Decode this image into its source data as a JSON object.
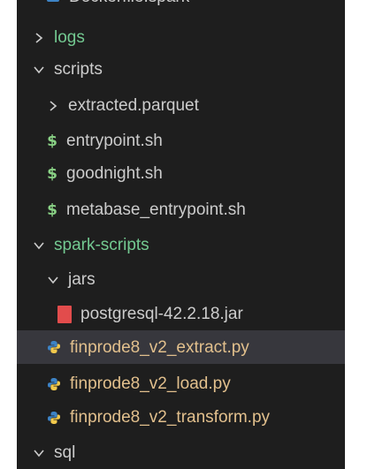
{
  "explorer": {
    "colors": {
      "background": "#1e1e1e",
      "selected_row": "#37373d",
      "text": "#cccccc",
      "git_untracked_folder": "#73c991",
      "git_modified_file": "#e2c08d",
      "shell_icon": "#89d185",
      "jar_icon": "#e24c4c",
      "python_icon_blue": "#3d83c5",
      "python_icon_yellow": "#f2c94c"
    },
    "items": [
      {
        "label": "Dockerfile.spark",
        "kind": "file",
        "icon": "docker-icon"
      },
      {
        "label": "logs",
        "kind": "folder",
        "state": "collapsed",
        "icon": "chevron-right-icon"
      },
      {
        "label": "scripts",
        "kind": "folder",
        "state": "expanded",
        "icon": "chevron-down-icon"
      },
      {
        "label": "extracted.parquet",
        "kind": "folder",
        "state": "collapsed",
        "icon": "chevron-right-icon"
      },
      {
        "label": "entrypoint.sh",
        "kind": "file",
        "icon": "shell-dollar-icon",
        "glyph": "$"
      },
      {
        "label": "goodnight.sh",
        "kind": "file",
        "icon": "shell-dollar-icon",
        "glyph": "$"
      },
      {
        "label": "metabase_entrypoint.sh",
        "kind": "file",
        "icon": "shell-dollar-icon",
        "glyph": "$"
      },
      {
        "label": "spark-scripts",
        "kind": "folder",
        "state": "expanded",
        "icon": "chevron-down-icon"
      },
      {
        "label": "jars",
        "kind": "folder",
        "state": "expanded",
        "icon": "chevron-down-icon"
      },
      {
        "label": "postgresql-42.2.18.jar",
        "kind": "file",
        "icon": "jar-icon"
      },
      {
        "label": "finprode8_v2_extract.py",
        "kind": "file",
        "icon": "python-icon",
        "selected": true
      },
      {
        "label": "finprode8_v2_load.py",
        "kind": "file",
        "icon": "python-icon"
      },
      {
        "label": "finprode8_v2_transform.py",
        "kind": "file",
        "icon": "python-icon"
      },
      {
        "label": "sql",
        "kind": "folder",
        "state": "expanded",
        "icon": "chevron-down-icon"
      }
    ]
  }
}
